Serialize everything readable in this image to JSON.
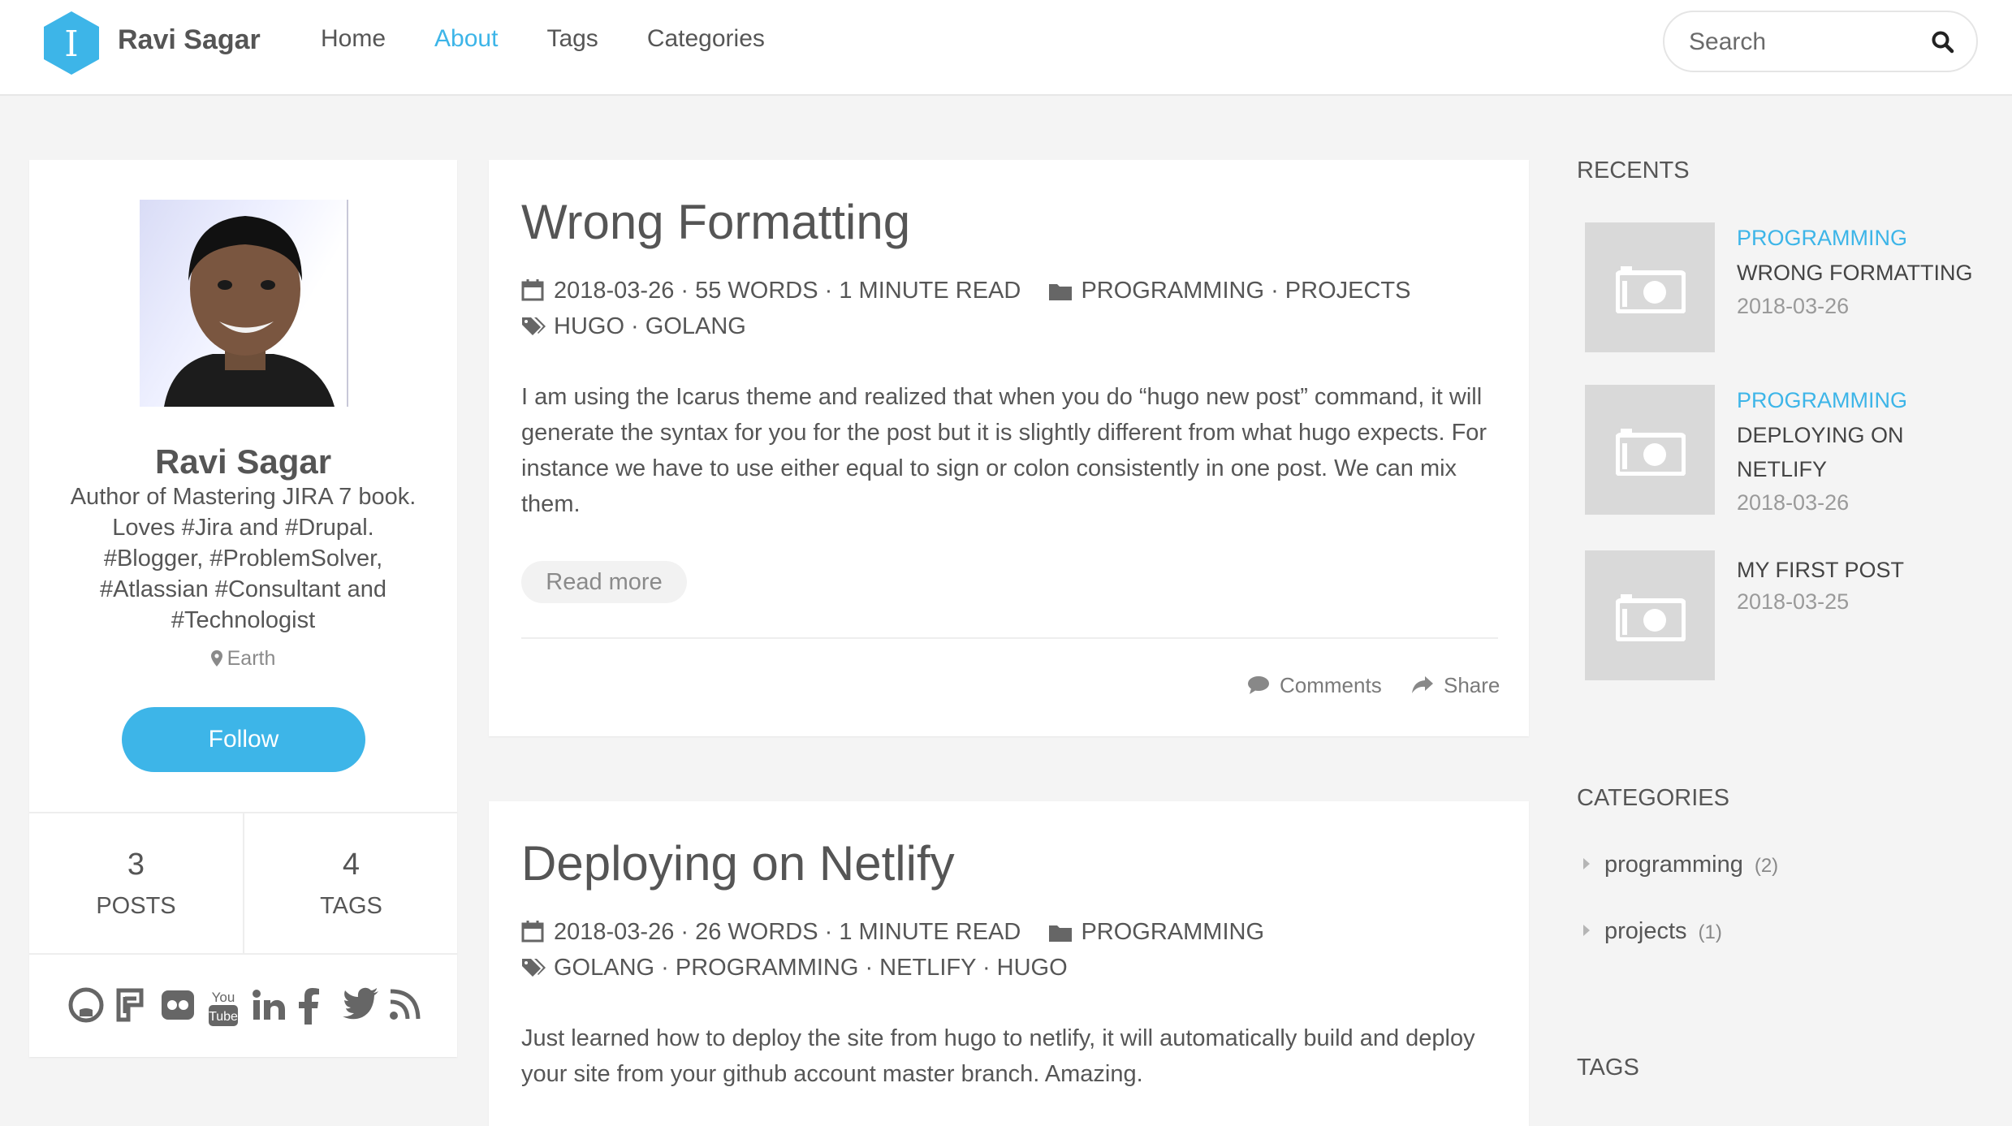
{
  "header": {
    "brand": "Ravi Sagar",
    "logo_letter": "I",
    "nav": [
      "Home",
      "About",
      "Tags",
      "Categories"
    ],
    "active_nav": "About",
    "search_placeholder": "Search"
  },
  "profile": {
    "name": "Ravi Sagar",
    "bio": "Author of Mastering JIRA 7 book. Loves #Jira and #Drupal. #Blogger, #ProblemSolver, #Atlassian #Consultant and #Technologist",
    "location": "Earth",
    "follow_label": "Follow",
    "stats": [
      {
        "value": "3",
        "label": "POSTS"
      },
      {
        "value": "4",
        "label": "TAGS"
      }
    ],
    "social_icons": [
      "github-icon",
      "freecodecamp-icon",
      "flickr-icon",
      "youtube-icon",
      "linkedin-icon",
      "facebook-icon",
      "twitter-icon",
      "rss-icon"
    ]
  },
  "posts": [
    {
      "title": "Wrong Formatting",
      "meta_line": "2018-03-26 · 55 WORDS · 1 MINUTE READ",
      "categories": "PROGRAMMING · PROJECTS",
      "tags": "HUGO · GOLANG",
      "excerpt": "I am using the Icarus theme and realized that when you do “hugo new post” command, it will generate the syntax for you for the post but it is slightly different from what hugo expects. For instance we have to use either equal to sign or colon consistently in one post. We can mix them.",
      "read_more": "Read more",
      "comments": "Comments",
      "share": "Share"
    },
    {
      "title": "Deploying on Netlify",
      "meta_line": "2018-03-26 · 26 WORDS · 1 MINUTE READ",
      "categories": "PROGRAMMING",
      "tags": "GOLANG · PROGRAMMING · NETLIFY · HUGO",
      "excerpt": "Just learned how to deploy the site from hugo to netlify, it will automatically build and deploy your site from your github account master branch. Amazing."
    }
  ],
  "sidebar": {
    "recents_heading": "RECENTS",
    "recents": [
      {
        "category": "PROGRAMMING",
        "title": "WRONG FORMATTING",
        "date": "2018-03-26"
      },
      {
        "category": "PROGRAMMING",
        "title": "DEPLOYING ON NETLIFY",
        "date": "2018-03-26"
      },
      {
        "category": "",
        "title": "MY FIRST POST",
        "date": "2018-03-25"
      }
    ],
    "categories_heading": "CATEGORIES",
    "categories": [
      {
        "name": "programming",
        "count": "(2)"
      },
      {
        "name": "projects",
        "count": "(1)"
      }
    ],
    "tags_heading": "TAGS"
  },
  "colors": {
    "accent": "#3db5e8",
    "background": "#f4f4f4",
    "text": "#565656"
  }
}
